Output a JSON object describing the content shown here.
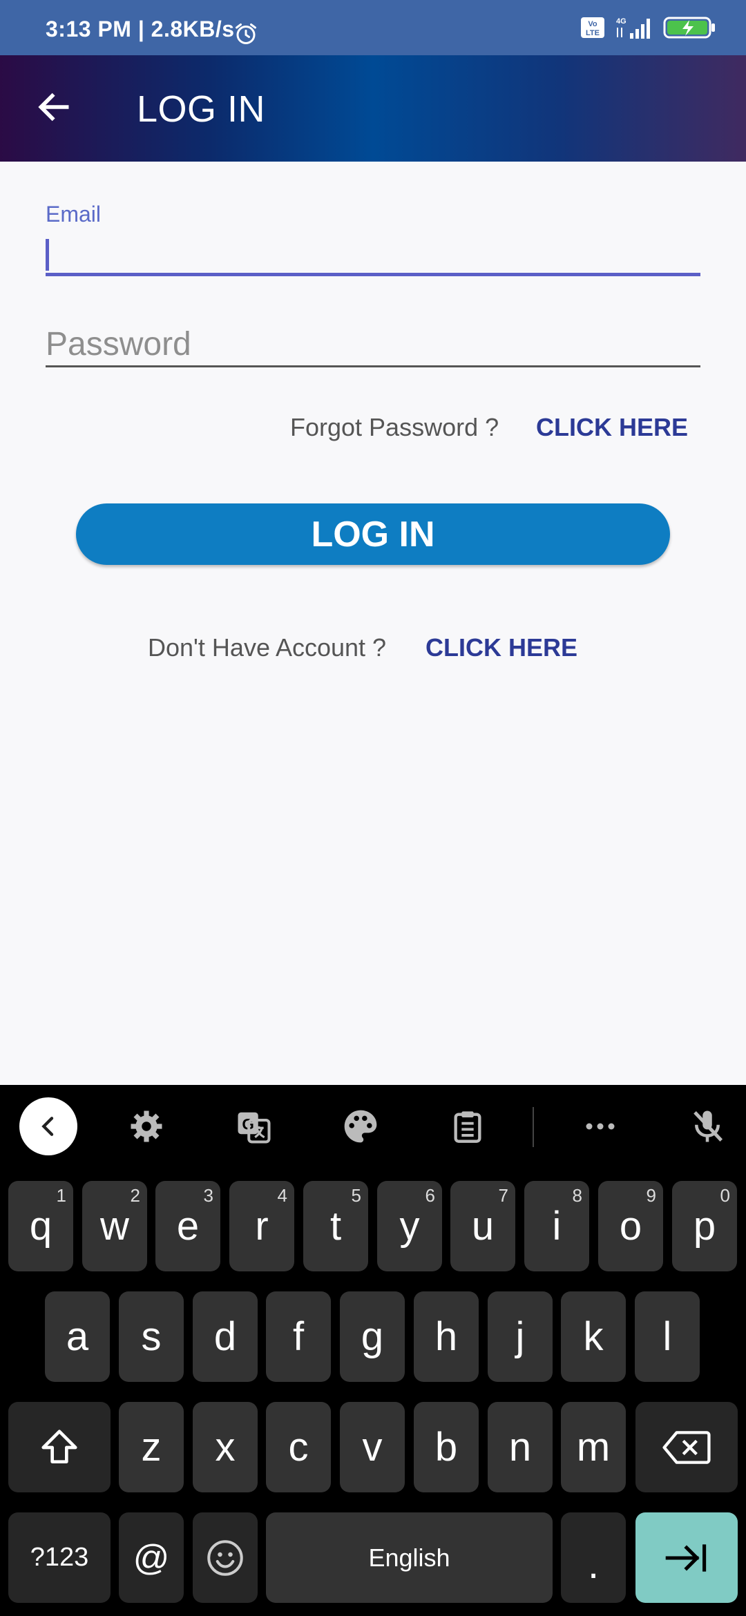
{
  "status_bar": {
    "time_speed": "3:13 PM | 2.8KB/s",
    "network_type": "4G",
    "volte_label": "Vo LTE"
  },
  "app_bar": {
    "title": "LOG IN"
  },
  "form": {
    "email_label": "Email",
    "email_value": "",
    "password_placeholder": "Password",
    "forgot_text": "Forgot Password ?",
    "forgot_link": "CLICK HERE",
    "login_button": "LOG IN",
    "signup_text": "Don't Have Account ?",
    "signup_link": "CLICK HERE"
  },
  "keyboard": {
    "toolbar_icons": [
      "collapse-icon",
      "settings-icon",
      "translate-icon",
      "theme-palette-icon",
      "clipboard-icon",
      "more-icon",
      "mic-off-icon"
    ],
    "row1": [
      {
        "label": "q",
        "num": "1"
      },
      {
        "label": "w",
        "num": "2"
      },
      {
        "label": "e",
        "num": "3"
      },
      {
        "label": "r",
        "num": "4"
      },
      {
        "label": "t",
        "num": "5"
      },
      {
        "label": "y",
        "num": "6"
      },
      {
        "label": "u",
        "num": "7"
      },
      {
        "label": "i",
        "num": "8"
      },
      {
        "label": "o",
        "num": "9"
      },
      {
        "label": "p",
        "num": "0"
      }
    ],
    "row2": [
      "a",
      "s",
      "d",
      "f",
      "g",
      "h",
      "j",
      "k",
      "l"
    ],
    "row3": [
      "z",
      "x",
      "c",
      "v",
      "b",
      "n",
      "m"
    ],
    "symbols_key": "?123",
    "at_key": "@",
    "space_key": "English",
    "period_key": "."
  },
  "colors": {
    "status_bar": "#3f66a6",
    "accent": "#5b5fc7",
    "login_button": "#0e7dc2",
    "link": "#2c3a96",
    "enter_key": "#80cbc4"
  }
}
